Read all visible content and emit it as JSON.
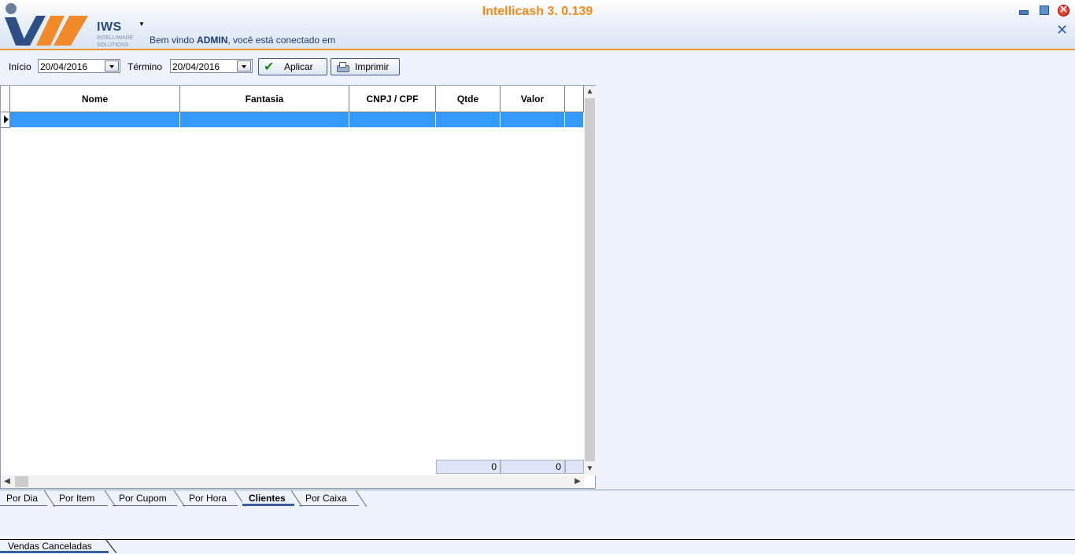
{
  "app": {
    "title": "Intellicash 3. 0.139",
    "brand": "IWS",
    "brand_sub_1": "INTELLIWARE",
    "brand_sub_2": "SOLUTIONS",
    "welcome_prefix": "Bem vindo ",
    "welcome_user": "ADMIN",
    "welcome_suffix": ", você está conectado em"
  },
  "filters": {
    "start_label": "Início",
    "start_value": "20/04/2016",
    "end_label": "Término",
    "end_value": "20/04/2016",
    "apply_label": "Aplicar",
    "print_label": "Imprimir"
  },
  "grid": {
    "columns": [
      "Nome",
      "Fantasia",
      "CNPJ / CPF",
      "Qtde",
      "Valor"
    ],
    "rows": [
      [
        "",
        "",
        "",
        "",
        ""
      ]
    ],
    "totals": {
      "qtde": "0",
      "valor": "0"
    }
  },
  "tabs": [
    "Por Dia",
    "Por Item",
    "Por Cupom",
    "Por Hora",
    "Clientes",
    "Por Caixa"
  ],
  "active_tab": "Clientes",
  "bottom_tab": "Vendas Canceladas",
  "colors": {
    "accent": "#f08a18",
    "selection": "#3399ff",
    "brand": "#2a4a7c"
  },
  "icons": [
    "logo-icon",
    "minimize-icon",
    "maximize-icon",
    "close-icon",
    "close-document-icon",
    "calendar-dropdown-icon",
    "check-icon",
    "printer-icon"
  ]
}
